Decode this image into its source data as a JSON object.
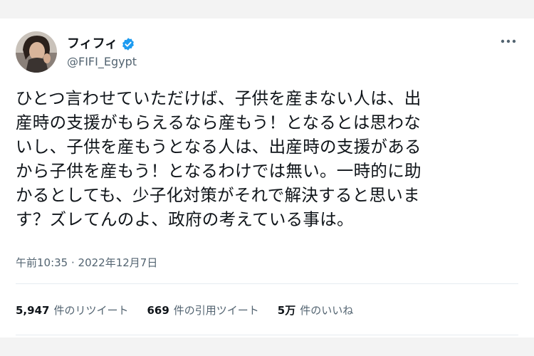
{
  "tweet": {
    "display_name": "フィフィ",
    "handle": "@FIFI_Egypt",
    "body": "ひとつ言わせていただけば、子供を産まない人は、出\n産時の支援がもらえるなら産もう！となるとは思わな\nいし、子供を産もうとなる人は、出産時の支援がある\nから子供を産もう！となるわけでは無い。一時的に助\nかるとしても、少子化対策がそれで解決すると思いま\nす？ズレてんのよ、政府の考えている事は。",
    "timestamp": "午前10:35 · 2022年12月7日",
    "stats": [
      {
        "number": "5,947",
        "label": "件のリツイート"
      },
      {
        "number": "669",
        "label": "件の引用ツイート"
      },
      {
        "number": "5万",
        "label": "件のいいね"
      }
    ]
  },
  "icons": {
    "verified": "verified-badge-icon",
    "more": "more-horizontal-icon"
  },
  "colors": {
    "verified": "#1d9bf0",
    "secondary_text": "#536471",
    "primary_text": "#0f1419"
  }
}
